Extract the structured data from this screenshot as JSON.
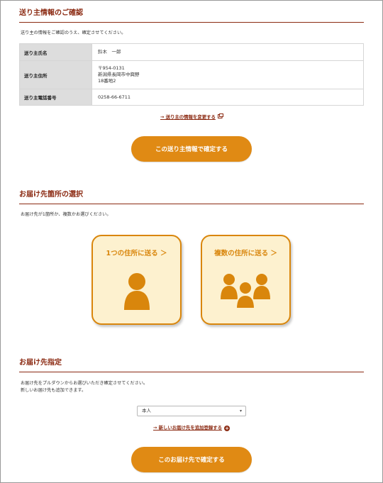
{
  "sender_section": {
    "title": "送り主情報のご確認",
    "note": "送り主の情報をご確認のうえ、確定させてください。",
    "rows": [
      {
        "label": "送り主氏名",
        "value_lines": [
          "鈴木　一郎"
        ]
      },
      {
        "label": "送り主住所",
        "value_lines": [
          "〒954-0131",
          "新潟県長岡市中興野",
          "18番地2"
        ]
      },
      {
        "label": "送り主電話番号",
        "value_lines": [
          "0258-66-6711"
        ]
      }
    ],
    "change_link": "→ 送り主の情報を変更する",
    "change_link_icon": "window-icon",
    "confirm_button": "この送り主情報で確定する"
  },
  "destination_select_section": {
    "title": "お届け先箇所の選択",
    "note": "お届け先が1箇所か、複数かお選びください。",
    "single_card": {
      "label": "1つの住所に送る ＞",
      "icon": "person-icon"
    },
    "multi_card": {
      "label": "複数の住所に送る ＞",
      "icon": "group-icon"
    }
  },
  "destination_section": {
    "title": "お届け先指定",
    "note_lines": [
      "お届け先をプルダウンからお選びいただき確定させてください。",
      "新しいお届け先も追加できます。"
    ],
    "selected_option": "本人",
    "add_link": "→ 新しいお届け先を追加登録する",
    "add_link_icon": "plus-circle-icon",
    "confirm_button": "このお届け先で確定する"
  },
  "colors": {
    "accent": "#e08a14",
    "heading": "#8b2a12",
    "card_bg": "#fdf1cf",
    "card_border": "#d9860c"
  }
}
